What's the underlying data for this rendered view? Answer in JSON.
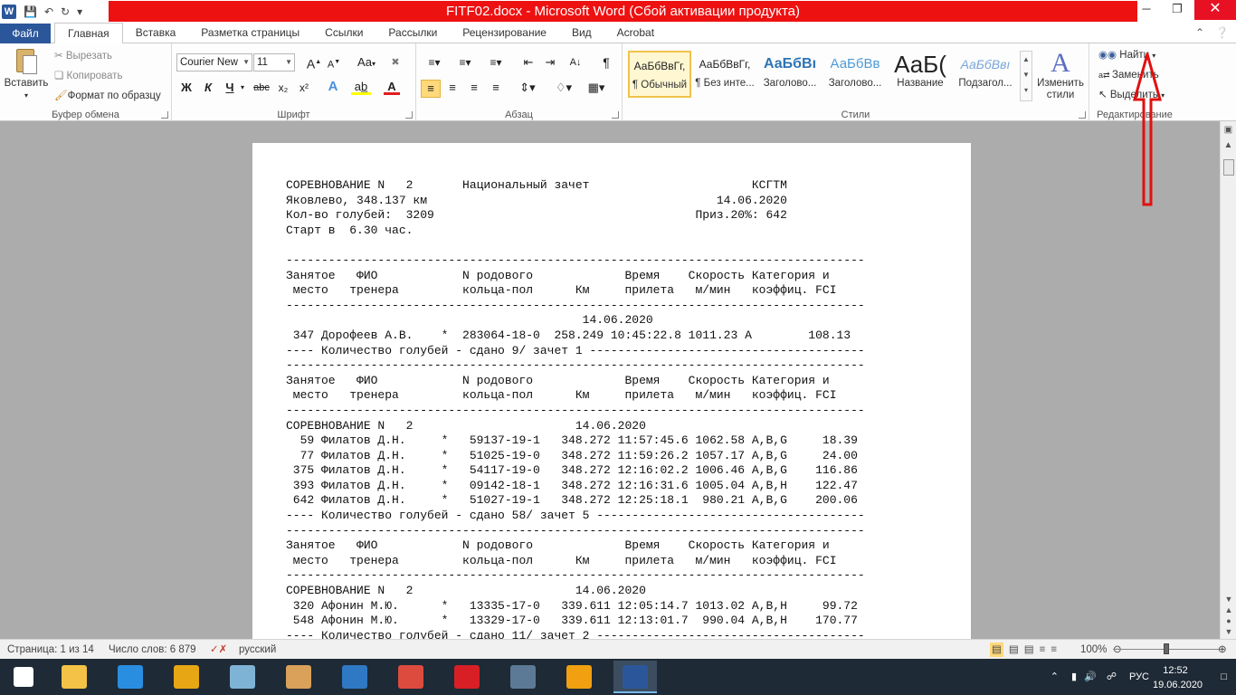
{
  "title": {
    "window_title": "FITF02.docx - Microsoft Word (Сбой активации продукта)",
    "app_icon": "W",
    "minimize": "─",
    "restore": "❐",
    "close": "✕"
  },
  "tabs": {
    "file": "Файл",
    "items": [
      "Главная",
      "Вставка",
      "Разметка страницы",
      "Ссылки",
      "Рассылки",
      "Рецензирование",
      "Вид",
      "Acrobat"
    ],
    "active": "Главная"
  },
  "ribbon": {
    "clipboard": {
      "label": "Буфер обмена",
      "paste": "Вставить",
      "cut": "Вырезать",
      "copy": "Копировать",
      "format_painter": "Формат по образцу"
    },
    "font": {
      "label": "Шрифт",
      "family": "Courier New",
      "size": "11",
      "grow": "A",
      "shrink": "A",
      "case": "Aa",
      "bold": "Ж",
      "italic": "К",
      "underline": "Ч",
      "strike": "abc",
      "subscript": "x₂",
      "superscript": "x²",
      "highlight_color": "#ffff00",
      "font_color": "#e01e1e"
    },
    "paragraph": {
      "label": "Абзац"
    },
    "styles": {
      "label": "Стили",
      "items": [
        {
          "sample": "АаБбВвГг,",
          "name": "¶ Обычный"
        },
        {
          "sample": "АаБбВвГг,",
          "name": "¶ Без инте..."
        },
        {
          "sample": "АаБбВı",
          "name": "Заголово..."
        },
        {
          "sample": "АаБбВв",
          "name": "Заголово..."
        },
        {
          "sample": "АаБ(",
          "name": "Название"
        },
        {
          "sample": "АаБбВвı",
          "name": "Подзагол..."
        }
      ],
      "change_styles": "Изменить стили"
    },
    "editing": {
      "label": "Редактирование",
      "find": "Найти",
      "replace": "Заменить",
      "select": "Выделить"
    }
  },
  "document": {
    "lines": [
      "СОРЕВНОВАНИЕ N   2       Национальный зачет                       КСГТМ",
      "Яковлево, 348.137 км                                         14.06.2020",
      "Кол-во голубей:  3209                                     Приз.20%: 642",
      "Старт в  6.30 час.",
      "",
      "----------------------------------------------------------------------------------",
      "Занятое   ФИО            N родового             Время    Скорость Категория и",
      " место   тренера         кольца-пол      Км     прилета   м/мин   коэффиц. FCI",
      "----------------------------------------------------------------------------------",
      "                                          14.06.2020",
      " 347 Дорофеев А.В.    *  283064-18-0  258.249 10:45:22.8 1011.23 A        108.13",
      "---- Количество голубей - сдано 9/ зачет 1 ---------------------------------------",
      "----------------------------------------------------------------------------------",
      "Занятое   ФИО            N родового             Время    Скорость Категория и",
      " место   тренера         кольца-пол      Км     прилета   м/мин   коэффиц. FCI",
      "----------------------------------------------------------------------------------",
      "СОРЕВНОВАНИЕ N   2                       14.06.2020",
      "  59 Филатов Д.Н.     *   59137-19-1   348.272 11:57:45.6 1062.58 A,B,G     18.39",
      "  77 Филатов Д.Н.     *   51025-19-0   348.272 11:59:26.2 1057.17 A,B,G     24.00",
      " 375 Филатов Д.Н.     *   54117-19-0   348.272 12:16:02.2 1006.46 A,B,G    116.86",
      " 393 Филатов Д.Н.     *   09142-18-1   348.272 12:16:31.6 1005.04 A,B,H    122.47",
      " 642 Филатов Д.Н.     *   51027-19-1   348.272 12:25:18.1  980.21 A,B,G    200.06",
      "---- Количество голубей - сдано 58/ зачет 5 --------------------------------------",
      "----------------------------------------------------------------------------------",
      "Занятое   ФИО            N родового             Время    Скорость Категория и",
      " место   тренера         кольца-пол      Км     прилета   м/мин   коэффиц. FCI",
      "----------------------------------------------------------------------------------",
      "СОРЕВНОВАНИЕ N   2                       14.06.2020",
      " 320 Афонин М.Ю.      *   13335-17-0   339.611 12:05:14.7 1013.02 A,B,H     99.72",
      " 548 Афонин М.Ю.      *   13329-17-0   339.611 12:13:01.7  990.04 A,B,H    170.77",
      "---- Количество голубей - сдано 11/ зачет 2 --------------------------------------"
    ]
  },
  "status": {
    "page": "Страница: 1 из 14",
    "words": "Число слов: 6 879",
    "language": "русский",
    "zoom": "100%",
    "zoom_fraction": 0.5
  },
  "taskbar": {
    "apps": [
      "start-icon",
      "file-explorer-icon",
      "media-player-icon",
      "fl-studio-icon",
      "notepad-icon",
      "paint-icon",
      "thunderbird-icon",
      "chrome-icon",
      "opera-icon",
      "calculator-icon",
      "t-app-icon",
      "word-icon"
    ],
    "colors": [
      "#ffffff",
      "#f4c246",
      "#2a8ee0",
      "#e7a614",
      "#7fb3d5",
      "#d9a15a",
      "#2f78c4",
      "#dd4b3e",
      "#d81f26",
      "#5c7a95",
      "#f0a010",
      "#2b579a"
    ],
    "lang": "РУС",
    "time": "12:52",
    "date": "19.06.2020"
  },
  "colors": {
    "word_blue": "#2b579a",
    "title_red": "#ee1111",
    "annotation_red": "#e01010"
  }
}
